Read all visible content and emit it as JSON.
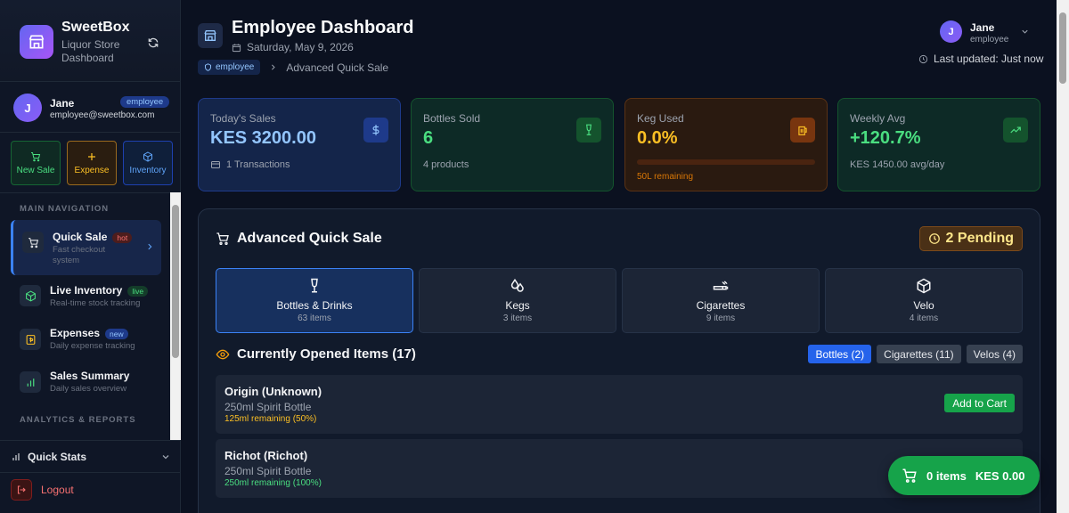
{
  "brand": {
    "name": "SweetBox",
    "subtitle": "Liquor Store Dashboard"
  },
  "user": {
    "name": "Jane",
    "email": "employee@sweetbox.com",
    "role": "employee",
    "initial": "J"
  },
  "quick_actions": [
    {
      "label": "New Sale",
      "icon": "cart-icon"
    },
    {
      "label": "Expense",
      "icon": "plus-icon"
    },
    {
      "label": "Inventory",
      "icon": "box-icon"
    }
  ],
  "nav": {
    "section_main": "MAIN NAVIGATION",
    "section_analytics": "ANALYTICS & REPORTS",
    "items": [
      {
        "title": "Quick Sale",
        "tag": "hot",
        "desc": "Fast checkout system"
      },
      {
        "title": "Live Inventory",
        "tag": "live",
        "desc": "Real-time stock tracking"
      },
      {
        "title": "Expenses",
        "tag": "new",
        "desc": "Daily expense tracking"
      },
      {
        "title": "Sales Summary",
        "tag": "",
        "desc": "Daily sales overview"
      }
    ],
    "quick_stats": "Quick Stats",
    "logout": "Logout"
  },
  "header": {
    "title": "Employee Dashboard",
    "date": "Saturday, May 9, 2026",
    "breadcrumb_badge": "employee",
    "breadcrumb_current": "Advanced Quick Sale",
    "user_name": "Jane",
    "user_role": "employee",
    "last_updated": "Last updated: Just now"
  },
  "stats": [
    {
      "label": "Today's Sales",
      "value": "KES 3200.00",
      "sub": "1 Transactions",
      "icon": "dollar-icon"
    },
    {
      "label": "Bottles Sold",
      "value": "6",
      "sub": "4 products",
      "icon": "wine-glass-icon"
    },
    {
      "label": "Keg Used",
      "value": "0.0%",
      "sub": "50L remaining",
      "icon": "beer-mug-icon",
      "progress": 0.0
    },
    {
      "label": "Weekly Avg",
      "value": "+120.7%",
      "sub": "KES 1450.00 avg/day",
      "icon": "trending-up-icon"
    }
  ],
  "panel": {
    "title": "Advanced Quick Sale",
    "pending": "2 Pending",
    "categories": [
      {
        "name": "Bottles & Drinks",
        "count": "63 items",
        "icon": "wine-glass-icon"
      },
      {
        "name": "Kegs",
        "count": "3 items",
        "icon": "drops-icon"
      },
      {
        "name": "Cigarettes",
        "count": "9 items",
        "icon": "cigarette-icon"
      },
      {
        "name": "Velo",
        "count": "4 items",
        "icon": "box-icon"
      }
    ],
    "opened_title": "Currently Opened Items (17)",
    "filters": [
      "Bottles (2)",
      "Cigarettes (11)",
      "Velos (4)"
    ],
    "items": [
      {
        "name": "Origin (Unknown)",
        "type": "250ml Spirit Bottle",
        "remaining": "125ml remaining (50%)",
        "color": "#fbbf24"
      },
      {
        "name": "Richot (Richot)",
        "type": "250ml Spirit Bottle",
        "remaining": "250ml remaining (100%)",
        "color": "#4ade80"
      }
    ],
    "add_to_cart": "Add to Cart"
  },
  "cart": {
    "items": "0 items",
    "total": "KES 0.00"
  }
}
